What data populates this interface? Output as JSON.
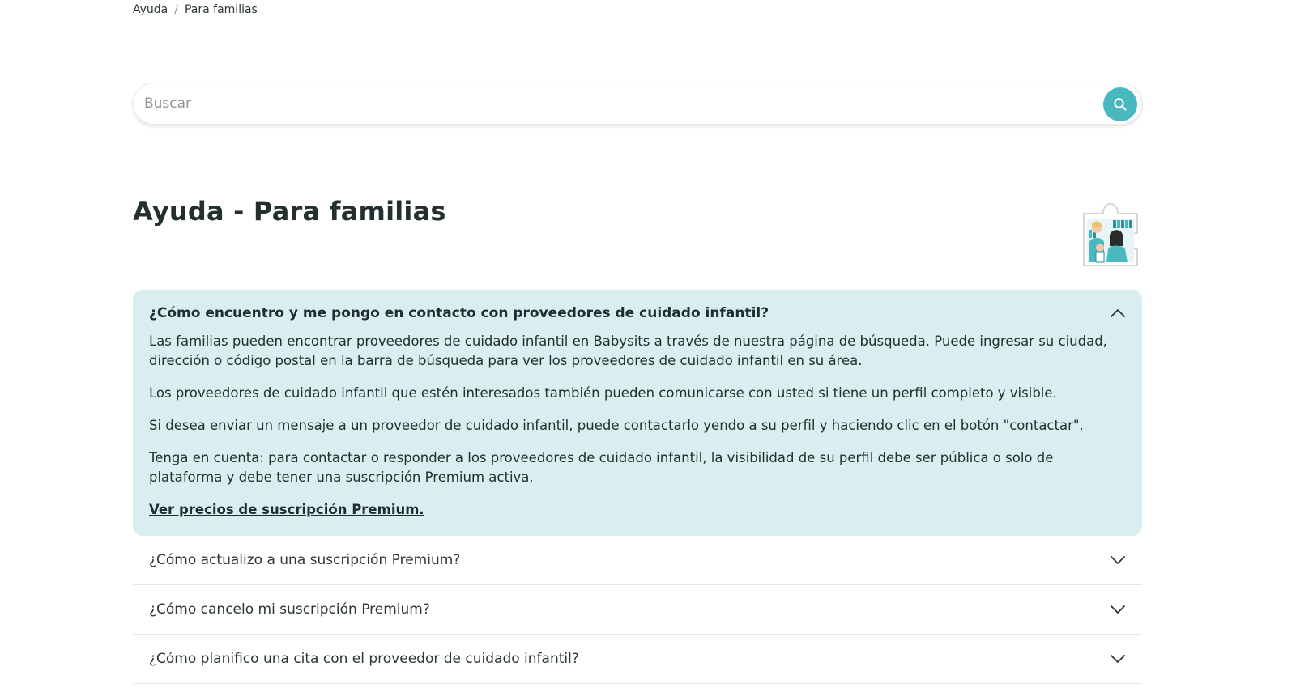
{
  "breadcrumb": {
    "items": [
      "Ayuda",
      "Para familias"
    ],
    "separator": "/"
  },
  "search": {
    "placeholder": "Buscar",
    "value": "",
    "button_icon": "search-icon"
  },
  "page": {
    "title": "Ayuda - Para familias"
  },
  "faq": {
    "open_item": {
      "question": "¿Cómo encuentro y me pongo en contacto con proveedores de cuidado infantil?",
      "icon": "chevron-up-icon",
      "paragraphs": [
        "Las familias pueden encontrar proveedores de cuidado infantil en Babysits a través de nuestra página de búsqueda. Puede ingresar su ciudad, dirección o código postal en la barra de búsqueda para ver los proveedores de cuidado infantil en su área.",
        "Los proveedores de cuidado infantil que estén interesados también pueden comunicarse con usted si tiene un perfil completo y visible.",
        "Si desea enviar un mensaje a un proveedor de cuidado infantil, puede contactarlo yendo a su perfil y haciendo clic en el botón \"contactar\".",
        "Tenga en cuenta: para contactar o responder a los proveedores de cuidado infantil, la visibilidad de su perfil debe ser pública o solo de plataforma y debe tener una suscripción Premium activa."
      ],
      "link": "Ver precios de suscripción Premium."
    },
    "items": [
      {
        "question": "¿Cómo actualizo a una suscripción Premium?",
        "icon": "chevron-down-icon"
      },
      {
        "question": "¿Cómo cancelo mi suscripción Premium?",
        "icon": "chevron-down-icon"
      },
      {
        "question": "¿Cómo planifico una cita con el proveedor de cuidado infantil?",
        "icon": "chevron-down-icon"
      }
    ]
  },
  "colors": {
    "accent": "#4ab9bf",
    "open_panel_bg": "#daeef0",
    "text": "#1f2d30"
  }
}
